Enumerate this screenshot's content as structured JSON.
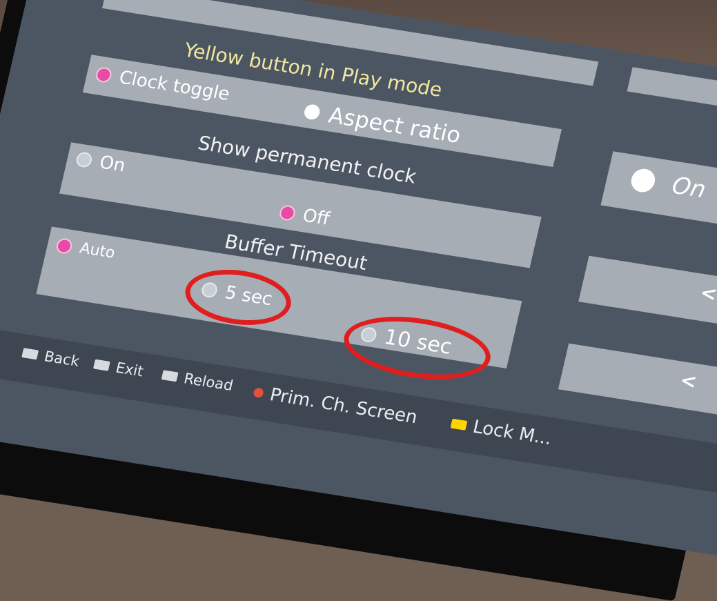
{
  "settings": {
    "yellow_button": {
      "title": "Yellow button in Play mode",
      "options": [
        {
          "label": "Clock toggle",
          "selected": true
        },
        {
          "label": "Aspect ratio",
          "selected": false
        }
      ]
    },
    "permanent_clock": {
      "title": "Show permanent clock",
      "options": [
        {
          "label": "On",
          "selected": false
        },
        {
          "label": "Off",
          "selected": true
        }
      ]
    },
    "buffer_timeout": {
      "title": "Buffer Timeout",
      "options": [
        {
          "label": "Auto",
          "selected": true
        },
        {
          "label": "5 sec",
          "selected": false
        },
        {
          "label": "10 sec",
          "selected": false
        }
      ]
    }
  },
  "right_panel": {
    "toggle_label": "On",
    "arrow_1": "<",
    "arrow_2": "<"
  },
  "footer": {
    "keys": [
      {
        "label": "Back"
      },
      {
        "label": "Exit"
      },
      {
        "label": "Reload"
      },
      {
        "label": "Prim. Ch. Screen"
      },
      {
        "label": "Lock M..."
      }
    ]
  },
  "colors": {
    "selected_dot": "#e94aa6",
    "highlight_ring": "#e01e1e",
    "prim_key": "#e1523d",
    "lock_key": "#ffd400"
  }
}
